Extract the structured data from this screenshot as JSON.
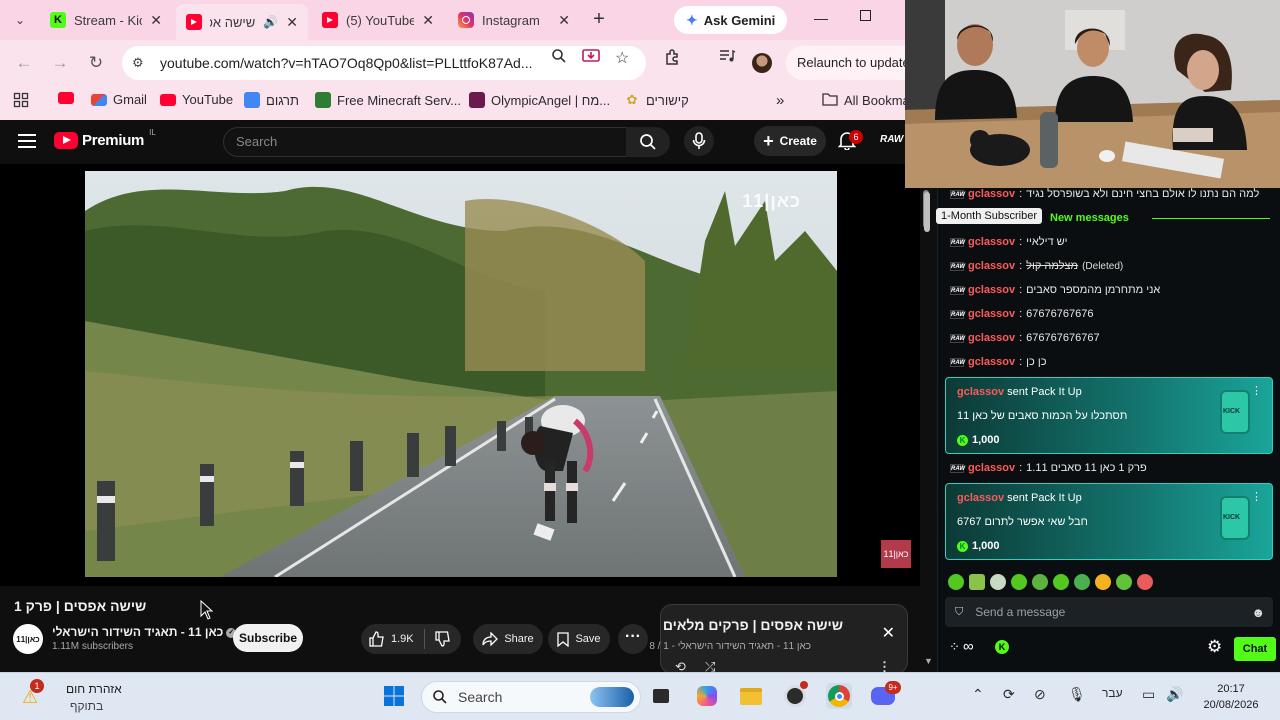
{
  "browser": {
    "tabs": [
      {
        "title": "Stream - Kic",
        "close": "✕",
        "favicon_color": "#53fc18"
      },
      {
        "title": "שישה אפ",
        "close": "✕",
        "favicon_color": "#ff0033"
      },
      {
        "title": "(5) YouTube",
        "close": "✕",
        "favicon_color": "#ff0033"
      },
      {
        "title": "Instagram",
        "close": "✕",
        "favicon_color": "#e1306c"
      }
    ],
    "gemini_label": "Ask Gemini",
    "url": "youtube.com/watch?v=hTAO7Oq8Qp0&list=PLLttfoK87Ad...",
    "relaunch_label": "Relaunch to update",
    "bookmarks": [
      "Gmail",
      "YouTube",
      "תרגום",
      "Free Minecraft Serv...",
      "OlympicAngel | מח...",
      "קישורים",
      "All Bookma"
    ],
    "overflow": "»",
    "accent": "#f9d5e6"
  },
  "youtube": {
    "logo": "Premium",
    "logo_region": "IL",
    "search_placeholder": "Search",
    "create_label": "Create",
    "notif_count": "6",
    "channel_mini": "RAW",
    "watermark": "כאן|11",
    "badge": "כאן|11",
    "video_title": "שישה אפסים | פרק 1",
    "channel_name": "כאן 11 - תאגיד השידור הישראלי",
    "channel_avatar": "כאן|11",
    "subscribers": "1.11M subscribers",
    "subscribe_label": "Subscribe",
    "likes": "1.9K",
    "share_label": "Share",
    "save_label": "Save",
    "playlist": {
      "title": "שישה אפסים | פרקים מלאים",
      "meta": "כאן 11 - תאגיד השידור הישראלי - 1 / 8"
    }
  },
  "chat": {
    "top_message": {
      "user": "gclassov",
      "text": "למה הם נתנו לו אולם בחצי חינם ולא בשופרסל נגיד"
    },
    "tooltip": "1-Month Subscriber",
    "new_messages": "New messages",
    "messages": [
      {
        "user": "gclassov",
        "text": "יש דילאיי"
      },
      {
        "user": "gclassov",
        "text": "מצלמה קול",
        "deleted": "(Deleted)"
      },
      {
        "user": "gclassov",
        "text": "אני מתחרמן מהמספר סאבים"
      },
      {
        "user": "gclassov",
        "text": "67676767676"
      },
      {
        "user": "gclassov",
        "text": "676767676767"
      },
      {
        "user": "gclassov",
        "text": "כן כן"
      }
    ],
    "gift1": {
      "user": "gclassov",
      "action": "sent Pack It Up",
      "text": "תסתכלו על הכמות סאבים של כאן 11",
      "amount": "1,000"
    },
    "mid_message": {
      "user": "gclassov",
      "text": "פרק 1 כאן 11 סאבים 1.11"
    },
    "gift2": {
      "user": "gclassov",
      "action": "sent Pack It Up",
      "text": "חבל שאי אפשר לתרום 6767",
      "amount": "1,000"
    },
    "send_placeholder": "Send a message",
    "chat_button": "Chat",
    "accent": "#53fc18",
    "username_color": "#ff5a5a"
  },
  "taskbar": {
    "weather_title": "אזהרת חום",
    "weather_sub": "בתוקף",
    "weather_badge": "1",
    "search_label": "Search",
    "lang": "עבר",
    "time": "20:17",
    "date": "20/08/2026",
    "discord_badge": "9+"
  }
}
